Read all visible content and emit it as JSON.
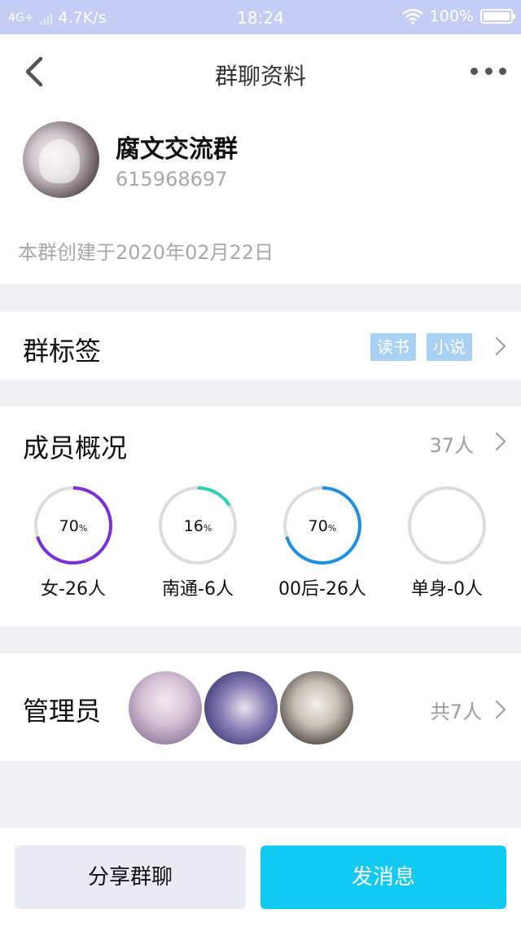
{
  "status_bar": {
    "network": "4G+",
    "speed": "4.7K/s",
    "time": "18:24",
    "battery": "100%"
  },
  "nav": {
    "title": "群聊资料",
    "back_icon": "chevron-left-icon",
    "more_icon": "more-dots-icon"
  },
  "group": {
    "name": "腐文交流群",
    "id": "615968697",
    "created": "本群创建于2020年02月22日"
  },
  "tags_section": {
    "title": "群标签",
    "tags": [
      "读书",
      "小说"
    ]
  },
  "members_section": {
    "title": "成员概况",
    "count": "37人",
    "stats": [
      {
        "percent": "70",
        "unit": "%",
        "label": "女-26人",
        "value": 0.7,
        "color": "#7b2fd6"
      },
      {
        "percent": "16",
        "unit": "%",
        "label": "南通-6人",
        "value": 0.16,
        "color": "#2ed0b0"
      },
      {
        "percent": "70",
        "unit": "%",
        "label": "00后-26人",
        "value": 0.7,
        "color": "#1f8fe0"
      },
      {
        "percent": "",
        "unit": "",
        "label": "单身-0人",
        "value": 0,
        "color": "#d9d9d9"
      }
    ]
  },
  "admins_section": {
    "title": "管理员",
    "count": "共7人"
  },
  "actions": {
    "share": "分享群聊",
    "send": "发消息"
  },
  "colors": {
    "status_bar_bg": "#c5cdf4",
    "tag_bg": "#a8d1f3",
    "send_button": "#12c9f2",
    "share_button": "#e8ebf3"
  }
}
